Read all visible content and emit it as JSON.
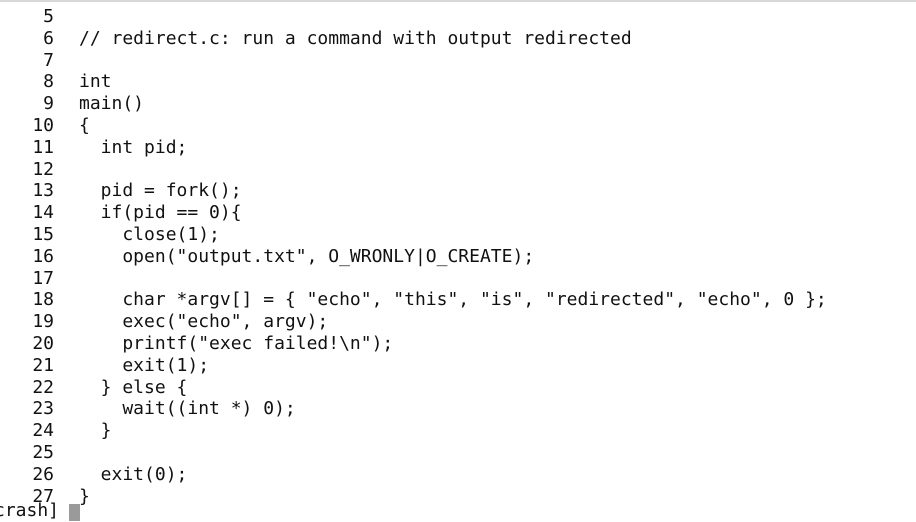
{
  "editor": {
    "lines": [
      {
        "n": "5",
        "text": ""
      },
      {
        "n": "6",
        "text": "// redirect.c: run a command with output redirected"
      },
      {
        "n": "7",
        "text": ""
      },
      {
        "n": "8",
        "text": "int"
      },
      {
        "n": "9",
        "text": "main()"
      },
      {
        "n": "10",
        "text": "{"
      },
      {
        "n": "11",
        "text": "  int pid;"
      },
      {
        "n": "12",
        "text": ""
      },
      {
        "n": "13",
        "text": "  pid = fork();"
      },
      {
        "n": "14",
        "text": "  if(pid == 0){"
      },
      {
        "n": "15",
        "text": "    close(1);"
      },
      {
        "n": "16",
        "text": "    open(\"output.txt\", O_WRONLY|O_CREATE);"
      },
      {
        "n": "17",
        "text": ""
      },
      {
        "n": "18",
        "text": "    char *argv[] = { \"echo\", \"this\", \"is\", \"redirected\", \"echo\", 0 };"
      },
      {
        "n": "19",
        "text": "    exec(\"echo\", argv);"
      },
      {
        "n": "20",
        "text": "    printf(\"exec failed!\\n\");"
      },
      {
        "n": "21",
        "text": "    exit(1);"
      },
      {
        "n": "22",
        "text": "  } else {"
      },
      {
        "n": "23",
        "text": "    wait((int *) 0);"
      },
      {
        "n": "24",
        "text": "  }"
      },
      {
        "n": "25",
        "text": ""
      },
      {
        "n": "26",
        "text": "  exit(0);"
      },
      {
        "n": "27",
        "text": "}"
      }
    ]
  },
  "prompt": {
    "text": "crash]"
  }
}
